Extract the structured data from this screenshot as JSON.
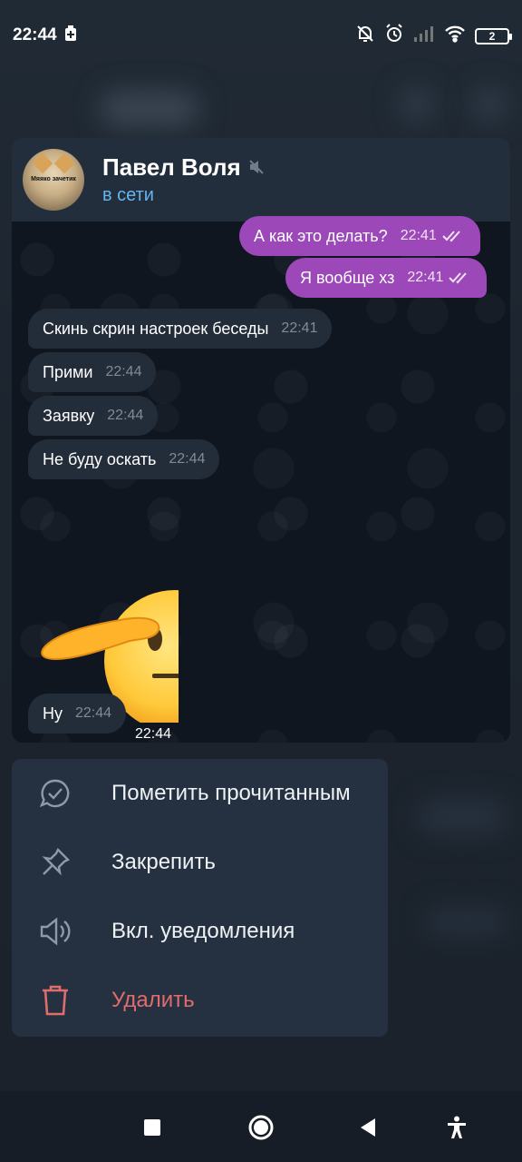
{
  "status_bar": {
    "time": "22:44",
    "battery_level": "2",
    "icons": [
      "battery-saver-icon",
      "mute-bell-icon",
      "alarm-icon",
      "signal-icon",
      "wifi-icon",
      "battery-icon"
    ]
  },
  "chat": {
    "contact_name": "Павел Воля",
    "contact_status": "в сети",
    "avatar_caption": "Мяяко зачетик",
    "messages": [
      {
        "direction": "out",
        "text": "А как это делать?",
        "time": "22:41",
        "read": true
      },
      {
        "direction": "out",
        "text": "Я вообще хз",
        "time": "22:41",
        "read": true
      },
      {
        "direction": "in",
        "text": "Скинь скрин настроек беседы",
        "time": "22:41"
      },
      {
        "direction": "in",
        "text": "Прими",
        "time": "22:44"
      },
      {
        "direction": "in",
        "text": "Заявку",
        "time": "22:44"
      },
      {
        "direction": "in",
        "text": "Не буду оскать",
        "time": "22:44"
      },
      {
        "direction": "in",
        "type": "sticker",
        "sticker": "saluting-face",
        "time": "22:44"
      },
      {
        "direction": "in",
        "text": "Ну",
        "time": "22:44"
      }
    ]
  },
  "context_menu": {
    "items": [
      {
        "label": "Пометить прочитанным",
        "icon": "mark-read-icon"
      },
      {
        "label": "Закрепить",
        "icon": "pin-icon"
      },
      {
        "label": "Вкл. уведомления",
        "icon": "unmute-icon"
      },
      {
        "label": "Удалить",
        "icon": "trash-icon",
        "color": "#e06c6c"
      }
    ]
  },
  "nav_bar": {
    "buttons": [
      "recents-button",
      "home-button",
      "back-button",
      "accessibility-button"
    ]
  },
  "colors": {
    "outgoing_bubble": "#9c48b8",
    "incoming_bubble": "#232d39",
    "status_link": "#64b5ef",
    "danger": "#e06c6c"
  }
}
